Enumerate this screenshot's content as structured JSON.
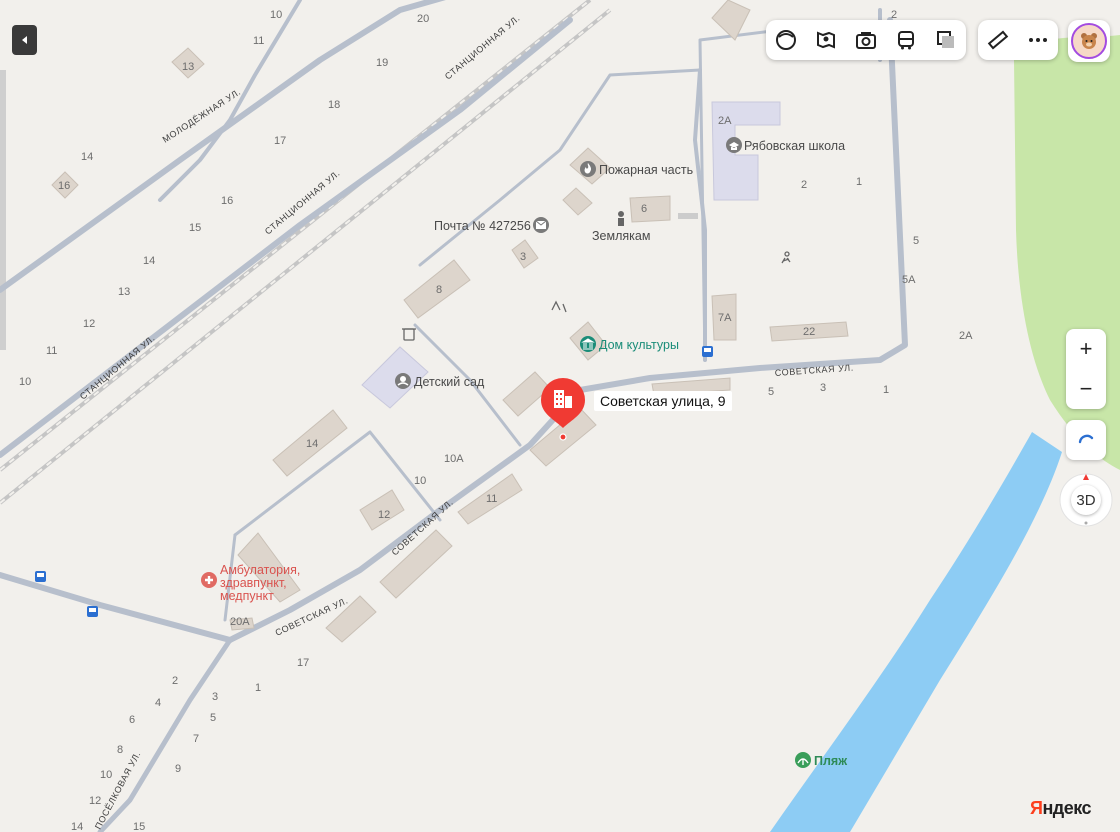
{
  "toolbar": {
    "collapse_icon": "chevron-left-icon",
    "layers": [
      "layer-toggle-icon",
      "panorama-icon",
      "photo-icon",
      "transit-icon",
      "map-layers-icon"
    ],
    "tools": [
      "ruler-icon",
      "more-icon"
    ],
    "avatar": "user-avatar"
  },
  "controls": {
    "zoom_in": "+",
    "zoom_out": "−",
    "mode_3d": "3D"
  },
  "streets": {
    "stantsionnaya_1": "СТАНЦИОННАЯ УЛ.",
    "stantsionnaya_2": "СТАНЦИОННАЯ УЛ.",
    "stantsionnaya_3": "СТАНЦИОННАЯ УЛ.",
    "molodezhnaya": "МОЛОДЁЖНАЯ УЛ.",
    "sovetskaya_1": "СОВЕТСКАЯ УЛ.",
    "sovetskaya_2": "СОВЕТСКАЯ УЛ.",
    "sovetskaya_3": "СОВЕТСКАЯ УЛ.",
    "poselkovaya": "ПОСЁЛКОВАЯ УЛ."
  },
  "pois": {
    "fire_station": "Пожарная часть",
    "school": "Рябовская школа",
    "post": "Почта № 427256",
    "monument": "Землякам",
    "culture_house": "Дом культуры",
    "kindergarten": "Детский сад",
    "clinic_line1": "Амбулатория,",
    "clinic_line2": "здравпункт,",
    "clinic_line3": "медпункт",
    "beach": "Пляж"
  },
  "selected_place": {
    "label": "Советская улица, 9"
  },
  "house_numbers": {
    "h10a": "10",
    "h20": "20",
    "h11a": "11",
    "h13": "13",
    "h19": "19",
    "h18": "18",
    "h17a": "17",
    "h14a": "14",
    "h16a": "16",
    "h16b": "16",
    "h15a": "15",
    "h14b": "14",
    "h13b": "13",
    "h12a": "12",
    "h11b": "11",
    "h10b": "10",
    "h2a": "2А",
    "h2b": "2",
    "h1a": "1",
    "h6": "6",
    "h5": "5",
    "h5a": "5А",
    "h3a": "3",
    "h8": "8",
    "h7a": "7А",
    "h22": "22",
    "h2a2": "2А",
    "h5b": "5",
    "h3b": "3",
    "h1b": "1",
    "h14c": "14",
    "h10a2": "10А",
    "h10c": "10",
    "h11c": "11",
    "h12b": "12",
    "h20a": "20А",
    "h17b": "17",
    "h2c": "2",
    "h4": "4",
    "h3c": "3",
    "h1c": "1",
    "h6b": "6",
    "h5c": "5",
    "h7": "7",
    "h8b": "8",
    "h9": "9",
    "h10d": "10",
    "h12c": "12",
    "h14d": "14",
    "h15b": "15",
    "h2top": "2"
  },
  "branding": {
    "logo_first": "Я",
    "logo_rest": "ндекс"
  },
  "colors": {
    "land": "#f2f0ec",
    "water": "#8dccf4",
    "park": "#c8e6a8",
    "road": "#b7bfcc",
    "building": "#ddd5cc",
    "pin": "#f03a33",
    "culture": "#1a8c78",
    "clinic": "#d9534f"
  }
}
